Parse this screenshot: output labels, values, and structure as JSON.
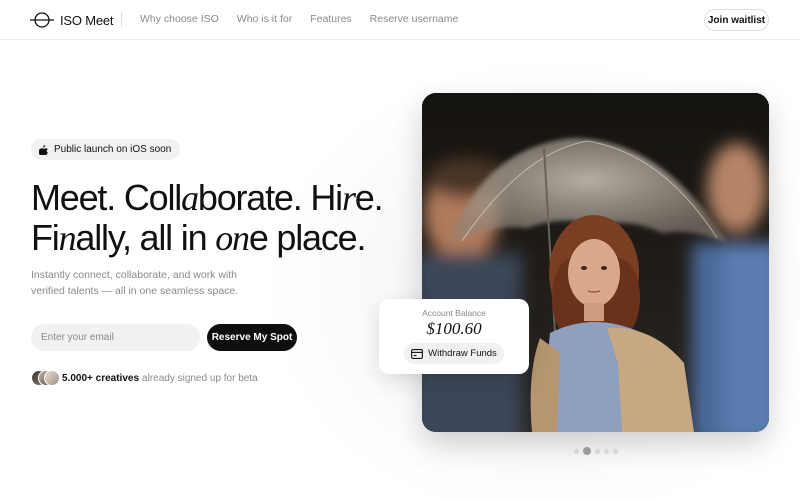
{
  "brand": {
    "name": "ISO Meet"
  },
  "nav": {
    "items": [
      "Why choose ISO",
      "Who is it for",
      "Features",
      "Reserve username"
    ],
    "cta": "Join waitlist"
  },
  "hero": {
    "badge": {
      "icon": "apple-icon",
      "label": "Public launch on iOS soon"
    },
    "headline": {
      "line1": {
        "a": "Meet. Coll",
        "b": "a",
        "c": "borate. Hi",
        "d": "r",
        "e": "e."
      },
      "line2": {
        "a": "Fi",
        "b": "n",
        "c": "ally, all in ",
        "d": "on",
        "e": "e place."
      }
    },
    "subtext": "Instantly connect, collaborate, and work with verified talents — all in one seamless space.",
    "email": {
      "placeholder": "Enter your email",
      "value": ""
    },
    "reserve_label": "Reserve My Spot",
    "social_proof": {
      "count": "5.000+ creatives",
      "text": "already signed up for beta"
    }
  },
  "balance_card": {
    "label": "Account Balance",
    "amount": "$100.60",
    "button_label": "Withdraw Funds",
    "button_icon": "wallet-icon"
  },
  "carousel": {
    "total": 5,
    "active": 2
  },
  "colors": {
    "text": "#111111",
    "muted": "#8a8a8a",
    "accent_dark": "#0e0e0e",
    "pill_bg": "#f1f1f1"
  }
}
